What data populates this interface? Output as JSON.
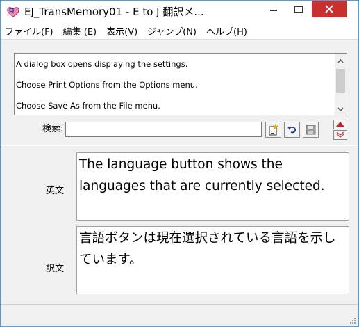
{
  "window": {
    "title": "EJ_TransMemory01 - E to J 翻訳メ...",
    "accent_color": "#5b9bd5",
    "close_color": "#c7302c"
  },
  "menu": {
    "items": [
      {
        "label": "ファイル(F)"
      },
      {
        "label": "編集 (E)"
      },
      {
        "label": "表示(V)"
      },
      {
        "label": "ジャンプ(N)"
      },
      {
        "label": "ヘルプ(H)"
      }
    ]
  },
  "list": {
    "rows": [
      "A dialog box opens displaying the settings.",
      "Choose Print Options from the Options menu.",
      "Choose Save As from the File menu."
    ]
  },
  "search": {
    "label": "検索:",
    "value": ""
  },
  "toolbar": {
    "icons": [
      "add-entry-icon",
      "undo-icon",
      "save-icon",
      "navigate-updown-icon"
    ]
  },
  "english": {
    "label": "英文",
    "text": "The language button shows the languages that are currently selected."
  },
  "japanese": {
    "label": "訳文",
    "text": "言語ボタンは現在選択されている言語を示しています。"
  }
}
